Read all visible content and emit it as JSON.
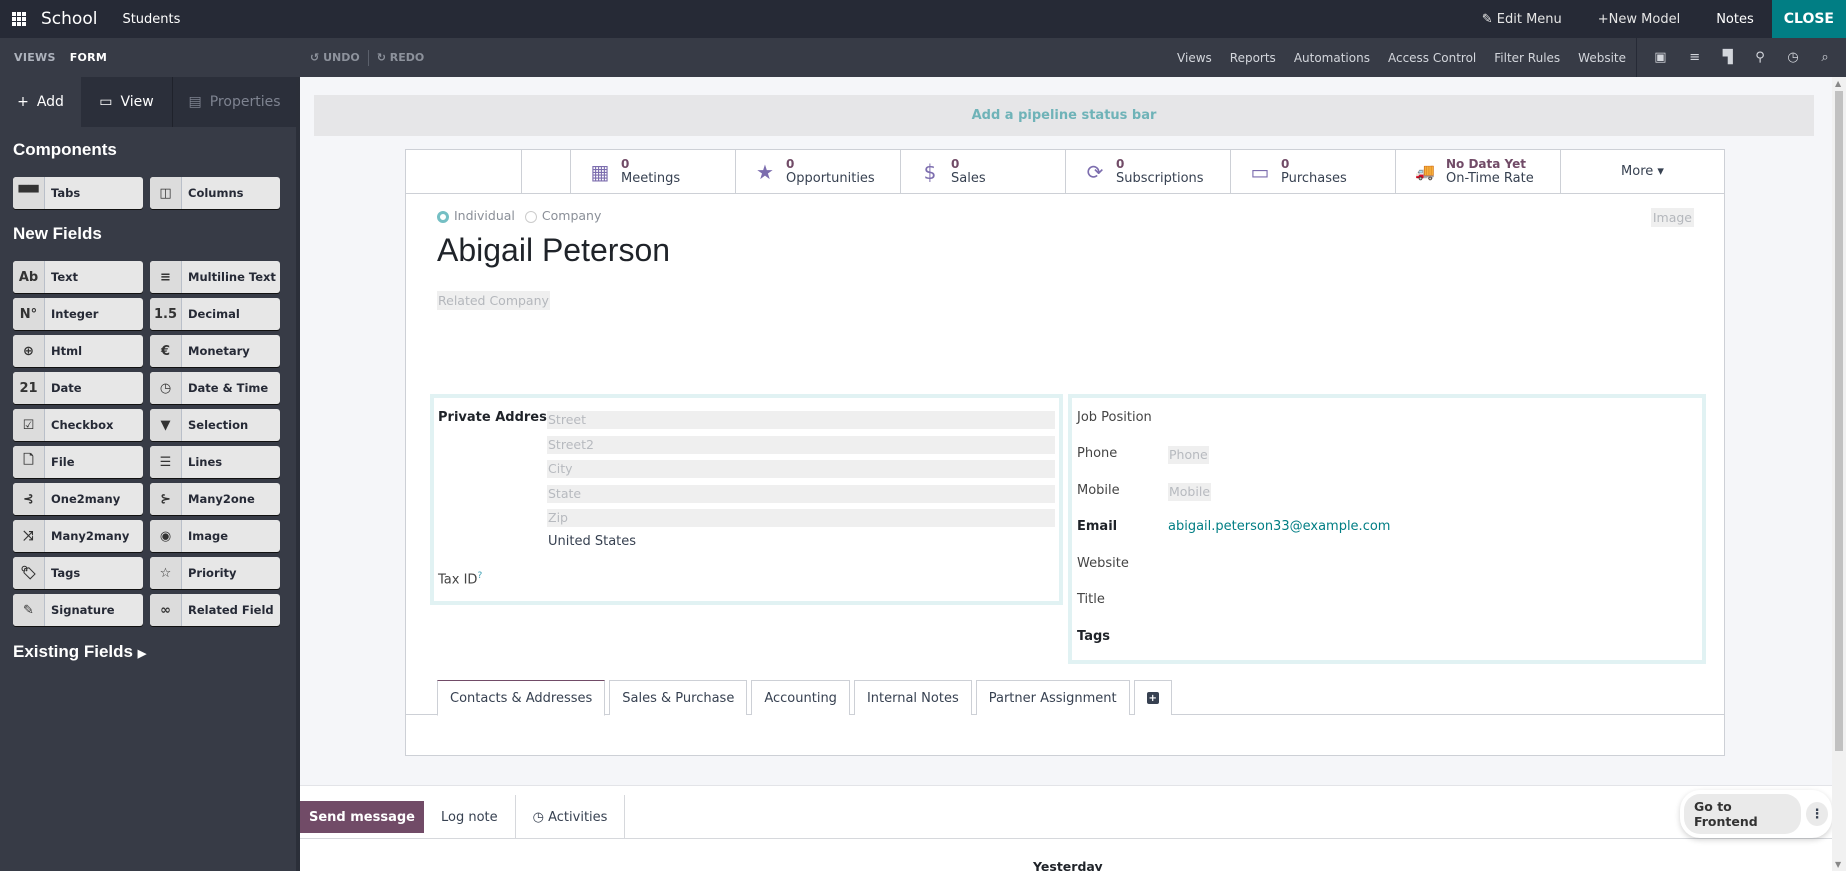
{
  "topbar": {
    "brand": "School",
    "menu": "Students",
    "edit_menu": "Edit Menu",
    "new_model": "New Model",
    "notes": "Notes",
    "close": "CLOSE"
  },
  "subbar": {
    "breadcrumb": [
      "VIEWS",
      "FORM"
    ],
    "undo": "UNDO",
    "redo": "REDO",
    "links": [
      "Views",
      "Reports",
      "Automations",
      "Access Control",
      "Filter Rules",
      "Website"
    ],
    "view_icons": [
      "form-view-icon",
      "list-view-icon",
      "kanban-view-icon",
      "map-view-icon",
      "activity-view-icon",
      "search-icon"
    ]
  },
  "sidebar": {
    "tabs": {
      "add": "Add",
      "view": "View",
      "properties": "Properties"
    },
    "components_title": "Components",
    "components": [
      {
        "icon": "▀▀",
        "label": "Tabs"
      },
      {
        "icon": "◫",
        "label": "Columns"
      }
    ],
    "new_fields_title": "New Fields",
    "new_fields": [
      {
        "icon": "Ab",
        "label": "Text"
      },
      {
        "icon": "≡",
        "label": "Multiline Text"
      },
      {
        "icon": "N°",
        "label": "Integer"
      },
      {
        "icon": "1.5",
        "label": "Decimal"
      },
      {
        "icon": "⊕",
        "label": "Html"
      },
      {
        "icon": "€",
        "label": "Monetary"
      },
      {
        "icon": "21",
        "label": "Date"
      },
      {
        "icon": "◷",
        "label": "Date & Time"
      },
      {
        "icon": "☑",
        "label": "Checkbox"
      },
      {
        "icon": "▼",
        "label": "Selection"
      },
      {
        "icon": "🗋",
        "label": "File"
      },
      {
        "icon": "☰",
        "label": "Lines"
      },
      {
        "icon": "⊰",
        "label": "One2many"
      },
      {
        "icon": "⊱",
        "label": "Many2one"
      },
      {
        "icon": "⤨",
        "label": "Many2many"
      },
      {
        "icon": "◉",
        "label": "Image"
      },
      {
        "icon": "🏷",
        "label": "Tags"
      },
      {
        "icon": "☆",
        "label": "Priority"
      },
      {
        "icon": "✎",
        "label": "Signature"
      },
      {
        "icon": "∞",
        "label": "Related Field"
      }
    ],
    "existing_fields": "Existing Fields"
  },
  "main": {
    "pipeline": "Add a pipeline status bar",
    "stats": [
      {
        "icon": "▦",
        "value": "0",
        "label": "Meetings"
      },
      {
        "icon": "★",
        "value": "0",
        "label": "Opportunities"
      },
      {
        "icon": "$",
        "value": "0",
        "label": "Sales"
      },
      {
        "icon": "⟳",
        "value": "0",
        "label": "Subscriptions"
      },
      {
        "icon": "▭",
        "value": "0",
        "label": "Purchases"
      },
      {
        "icon": "🚚",
        "value": "No Data Yet",
        "label": "On-Time Rate"
      }
    ],
    "more": "More ▾",
    "radio_individual": "Individual",
    "radio_company": "Company",
    "name": "Abigail Peterson",
    "related_company_placeholder": "Related Company",
    "image_placeholder": "Image",
    "left_group": {
      "private_address": "Private Address",
      "street": "Street",
      "street2": "Street2",
      "city": "City",
      "state": "State",
      "zip": "Zip",
      "country": "United States",
      "tax_id": "Tax ID",
      "tax_help": "?"
    },
    "right_group": {
      "job_position": "Job Position",
      "phone": "Phone",
      "phone_placeholder": "Phone",
      "mobile": "Mobile",
      "mobile_placeholder": "Mobile",
      "email": "Email",
      "email_value": "abigail.peterson33@example.com",
      "website": "Website",
      "title": "Title",
      "tags": "Tags"
    },
    "tabs": [
      "Contacts & Addresses",
      "Sales & Purchase",
      "Accounting",
      "Internal Notes",
      "Partner Assignment"
    ],
    "add_tab": "+"
  },
  "chatter": {
    "send_message": "Send message",
    "log_note": "Log note",
    "activities": "Activities",
    "yesterday": "Yesterday",
    "go_to_frontend": "Go to Frontend"
  },
  "colors": {
    "primary": "#714b67",
    "accent": "#017e84",
    "stat_icon": "#7c6dae"
  }
}
